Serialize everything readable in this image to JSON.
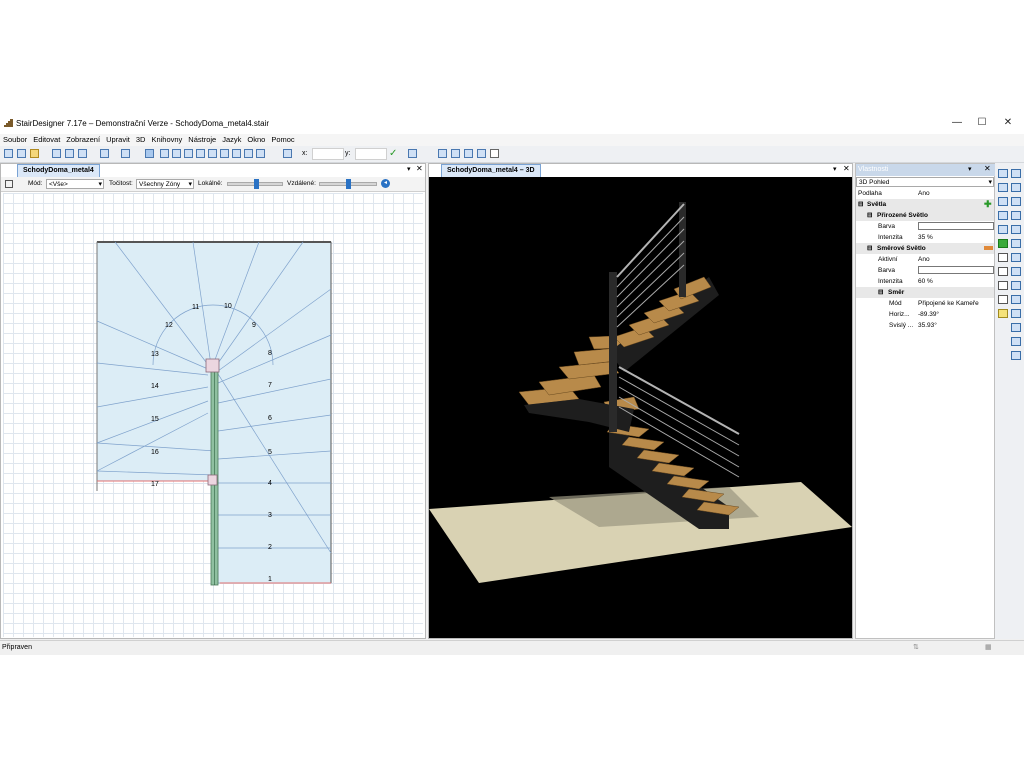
{
  "window": {
    "title": "StairDesigner 7.17e – Demonstrační Verze - SchodyDoma_metal4.stair",
    "minimize_glyph": "—",
    "maximize_glyph": "☐",
    "close_glyph": "✕",
    "app_icon": "stair-app-icon"
  },
  "menu": {
    "items": [
      "Soubor",
      "Editovat",
      "Zobrazení",
      "Upravit",
      "3D",
      "Knihovny",
      "Nástroje",
      "Jazyk",
      "Okno",
      "Pomoc"
    ]
  },
  "toolbar": {
    "x_label": "x:",
    "y_label": "y:"
  },
  "plan_view": {
    "tab_label": "SchodyDoma_metal4",
    "mode_label": "Mód:",
    "mode_value": "<Vše>",
    "rotation_label": "Točitost:",
    "rotation_value": "Všechny Zóny",
    "local_label": "Lokálně:",
    "distance_label": "Vzdálené:",
    "step_numbers": [
      "1",
      "2",
      "3",
      "4",
      "5",
      "6",
      "7",
      "8",
      "9",
      "10",
      "11",
      "12",
      "13",
      "14",
      "15",
      "16",
      "17"
    ]
  },
  "view3d": {
    "tab_label": "SchodyDoma_metal4 – 3D"
  },
  "properties": {
    "title": "Vlastnosti",
    "selector": "3D Pohled",
    "rows": {
      "podlaha_k": "Podlaha",
      "podlaha_v": "Ano",
      "svetla": "Světla",
      "prirozene": "Přirozené Světlo",
      "barva1_k": "Barva",
      "intenzita1_k": "Intenzita",
      "intenzita1_v": "35 %",
      "smerove": "Směrové Světlo",
      "aktivni_k": "Aktivní",
      "aktivni_v": "Ano",
      "barva2_k": "Barva",
      "intenzita2_k": "Intenzita",
      "intenzita2_v": "60 %",
      "smer": "Směr",
      "mod_k": "Mód",
      "mod_v": "Připojené ke Kameře",
      "horiz_k": "Horiz...",
      "horiz_v": "-89.39°",
      "svisly_k": "Svislý ...",
      "svisly_v": "35.93°"
    }
  },
  "statusbar": {
    "text": "Připraven"
  },
  "colors": {
    "plan_fill": "#dcedf6",
    "floor": "#d9d2b3",
    "tread": "#b88a4a",
    "stringer": "#1e1e1e",
    "railing": "#b4b4b4",
    "selection_blue": "#2a72c4"
  }
}
